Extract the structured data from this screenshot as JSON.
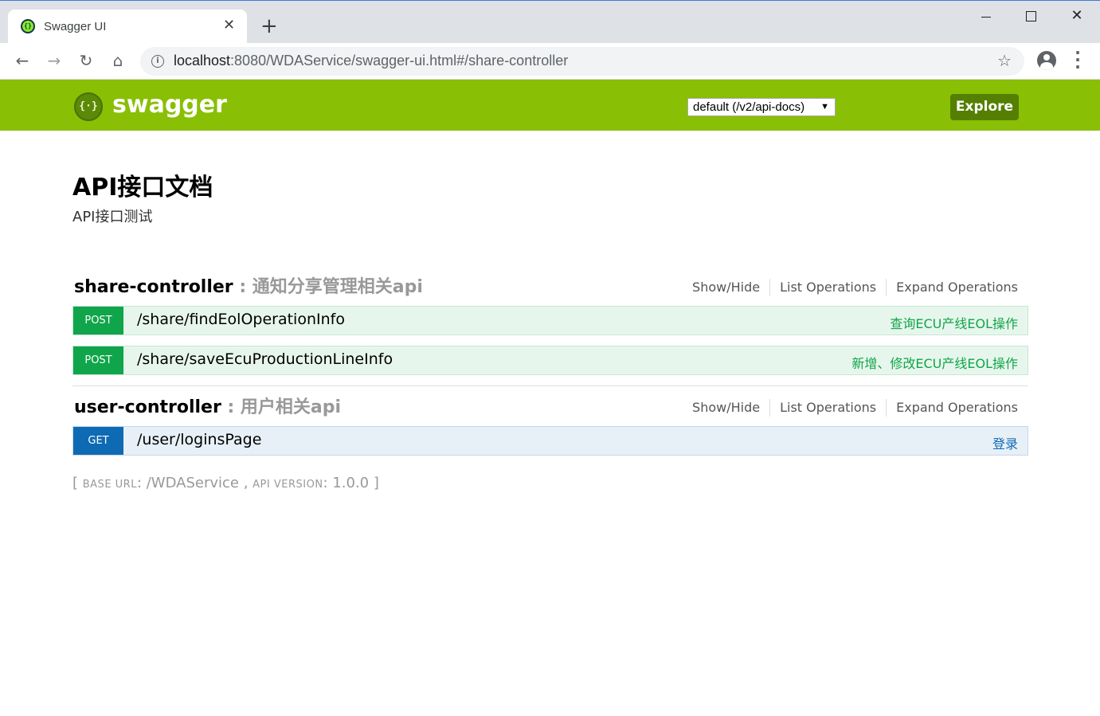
{
  "browser": {
    "tab_title": "Swagger UI",
    "tab_close": "✕",
    "new_tab": "+",
    "url_host": "localhost",
    "url_rest": ":8080/WDAService/swagger-ui.html#/share-controller"
  },
  "swagger": {
    "brand": "swagger",
    "spec_select": "default (/v2/api-docs)",
    "explore_label": "Explore",
    "accent_color": "#89bf04"
  },
  "info": {
    "title": "API接口文档",
    "description": "API接口测试"
  },
  "resources": [
    {
      "name": "share-controller",
      "description": " : 通知分享管理相关api",
      "links": [
        "Show/Hide",
        "List Operations",
        "Expand Operations"
      ],
      "operations": [
        {
          "method": "POST",
          "path": "/share/findEolOperationInfo",
          "summary": "查询ECU产线EOL操作"
        },
        {
          "method": "POST",
          "path": "/share/saveEcuProductionLineInfo",
          "summary": "新增、修改ECU产线EOL操作"
        }
      ]
    },
    {
      "name": "user-controller",
      "description": " : 用户相关api",
      "links": [
        "Show/Hide",
        "List Operations",
        "Expand Operations"
      ],
      "operations": [
        {
          "method": "GET",
          "path": "/user/loginsPage",
          "summary": "登录"
        }
      ]
    }
  ],
  "footer": {
    "open": "[ ",
    "base_url_label": "BASE URL",
    "base_url": ": /WDAService , ",
    "api_version_label": "API VERSION",
    "api_version": ": 1.0.0 ]"
  },
  "colors": {
    "post": "#10a54a",
    "get": "#0f6ab4"
  }
}
